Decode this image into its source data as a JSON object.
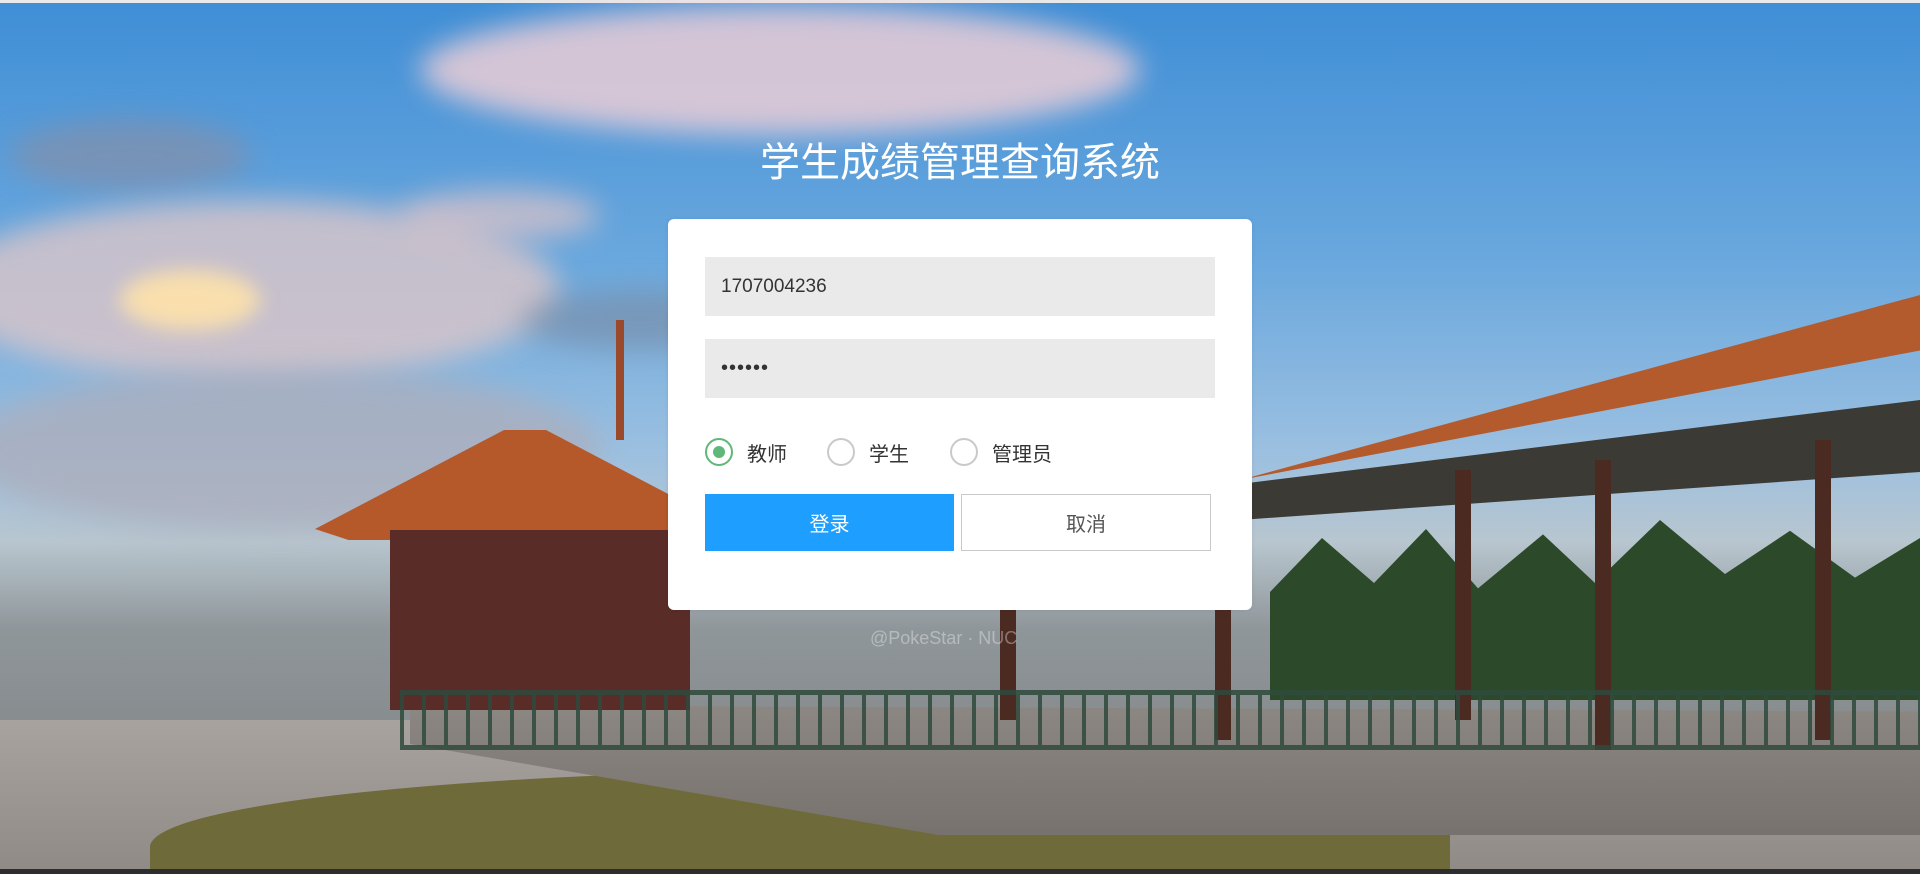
{
  "page": {
    "title": "学生成绩管理查询系统",
    "credit": "@PokeStar · NUC"
  },
  "form": {
    "username_value": "1707004236",
    "password_mask": "••••••",
    "roles": [
      {
        "label": "教师",
        "checked": true
      },
      {
        "label": "学生",
        "checked": false
      },
      {
        "label": "管理员",
        "checked": false
      }
    ],
    "login_label": "登录",
    "cancel_label": "取消"
  },
  "colors": {
    "primary_button": "#1e9fff",
    "radio_checked": "#5fb878",
    "input_background": "#eaeaea"
  }
}
